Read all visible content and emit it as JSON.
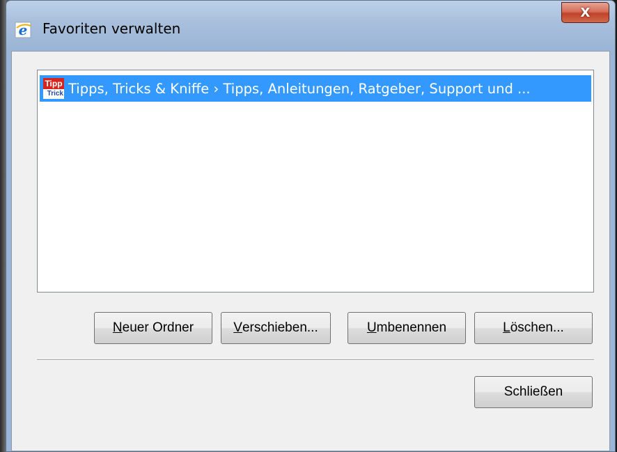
{
  "window": {
    "title": "Favoriten verwalten",
    "close_glyph": "X"
  },
  "favorites": {
    "items": [
      {
        "label": "Tipps, Tricks & Kniffe › Tipps, Anleitungen, Ratgeber, Support und ...",
        "icon_text_top": "Tipp",
        "icon_text_bottom": "Trick",
        "selected": true
      }
    ]
  },
  "buttons": {
    "new_folder": {
      "accel": "N",
      "rest": "euer Ordner"
    },
    "move": {
      "accel": "V",
      "rest": "erschieben..."
    },
    "rename": {
      "accel": "U",
      "rest": "mbenennen"
    },
    "delete": {
      "accel": "L",
      "rest": "öschen..."
    },
    "close": {
      "label": "Schließen"
    }
  },
  "colors": {
    "selection": "#3399ff",
    "dialog_bg": "#f0f0f0",
    "title_bar": "#a9c0dd",
    "close_button": "#c14429"
  }
}
